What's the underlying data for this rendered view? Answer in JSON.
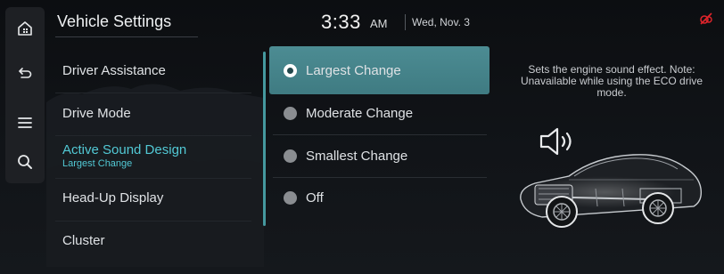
{
  "header": {
    "title": "Vehicle Settings",
    "time": "3:33",
    "ampm": "AM",
    "date": "Wed, Nov. 3"
  },
  "rail": {
    "items": [
      {
        "icon": "home-icon"
      },
      {
        "icon": "back-icon"
      },
      {
        "icon": "menu-icon"
      },
      {
        "icon": "search-icon"
      }
    ]
  },
  "menu": {
    "items": [
      {
        "label": "Driver Assistance"
      },
      {
        "label": "Drive Mode"
      },
      {
        "label": "Active Sound Design",
        "sublabel": "Largest Change",
        "active": true
      },
      {
        "label": "Head-Up Display"
      },
      {
        "label": "Cluster"
      }
    ]
  },
  "options": {
    "selected_index": 0,
    "items": [
      {
        "label": "Largest Change"
      },
      {
        "label": "Moderate Change"
      },
      {
        "label": "Smallest Change"
      },
      {
        "label": "Off"
      }
    ]
  },
  "info": {
    "description": "Sets the engine sound effect. Note: Unavailable while using the ECO drive mode."
  },
  "status": {
    "icon": "no-signal-icon",
    "color": "#e0242b"
  },
  "colors": {
    "accent": "#52c9d5",
    "selected_bg": "#4c8c93"
  }
}
